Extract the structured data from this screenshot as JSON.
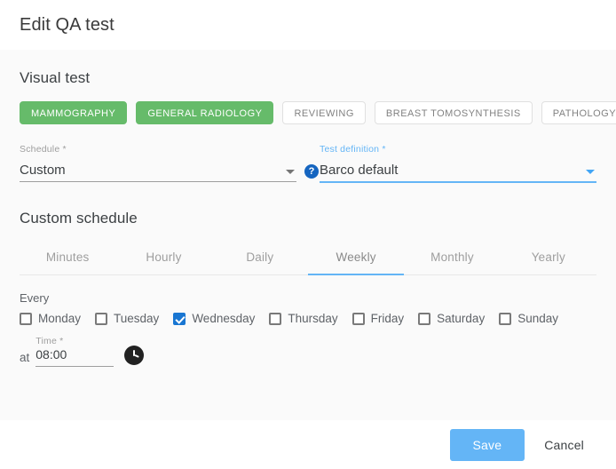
{
  "dialog": {
    "title": "Edit QA test"
  },
  "visual_test": {
    "section_title": "Visual test",
    "chips": [
      {
        "label": "MAMMOGRAPHY",
        "selected": true
      },
      {
        "label": "GENERAL RADIOLOGY",
        "selected": true
      },
      {
        "label": "REVIEWING",
        "selected": false
      },
      {
        "label": "BREAST TOMOSYNTHESIS",
        "selected": false
      },
      {
        "label": "PATHOLOGY",
        "selected": false
      }
    ],
    "schedule_field": {
      "label": "Schedule *",
      "value": "Custom",
      "help_icon": "?"
    },
    "test_definition_field": {
      "label": "Test definition *",
      "value": "Barco default"
    }
  },
  "custom_schedule": {
    "section_title": "Custom schedule",
    "tabs": [
      {
        "label": "Minutes",
        "active": false
      },
      {
        "label": "Hourly",
        "active": false
      },
      {
        "label": "Daily",
        "active": false
      },
      {
        "label": "Weekly",
        "active": true
      },
      {
        "label": "Monthly",
        "active": false
      },
      {
        "label": "Yearly",
        "active": false
      }
    ],
    "every_label": "Every",
    "days": [
      {
        "label": "Monday",
        "checked": false
      },
      {
        "label": "Tuesday",
        "checked": false
      },
      {
        "label": "Wednesday",
        "checked": true
      },
      {
        "label": "Thursday",
        "checked": false
      },
      {
        "label": "Friday",
        "checked": false
      },
      {
        "label": "Saturday",
        "checked": false
      },
      {
        "label": "Sunday",
        "checked": false
      }
    ],
    "time": {
      "at_label": "at",
      "label": "Time *",
      "value": "08:00"
    }
  },
  "footer": {
    "save_label": "Save",
    "cancel_label": "Cancel"
  },
  "colors": {
    "chip_selected": "#66BB6A",
    "accent_blue": "#64B5F6",
    "checkbox_checked": "#1976D2",
    "help_icon_blue": "#1565C0",
    "panel_background": "#FAFAFA"
  }
}
